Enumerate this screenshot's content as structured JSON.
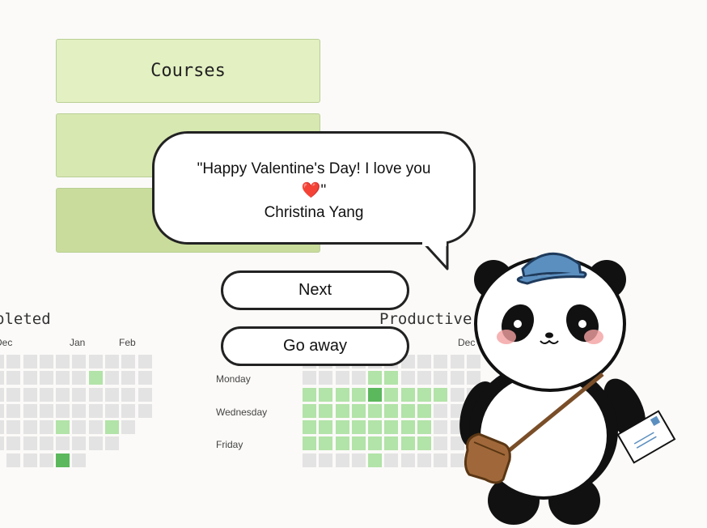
{
  "menu": {
    "courses_label": "Courses"
  },
  "left_section": {
    "title": "pleted",
    "months": [
      "Dec",
      "Jan",
      "Feb"
    ]
  },
  "right_section": {
    "title": "Productive",
    "months": [
      "Dec"
    ],
    "days": [
      "Monday",
      "Wednesday",
      "Friday"
    ]
  },
  "speech": {
    "quote_line1": "\"Happy Valentine's Day! I love you",
    "heart": "❤️",
    "quote_close": "\"",
    "author": "Christina Yang"
  },
  "buttons": {
    "next": "Next",
    "go_away": "Go away"
  },
  "colors": {
    "empty": "#e3e3e3",
    "light": "#b2e3a8",
    "dark": "#5cb85c"
  }
}
